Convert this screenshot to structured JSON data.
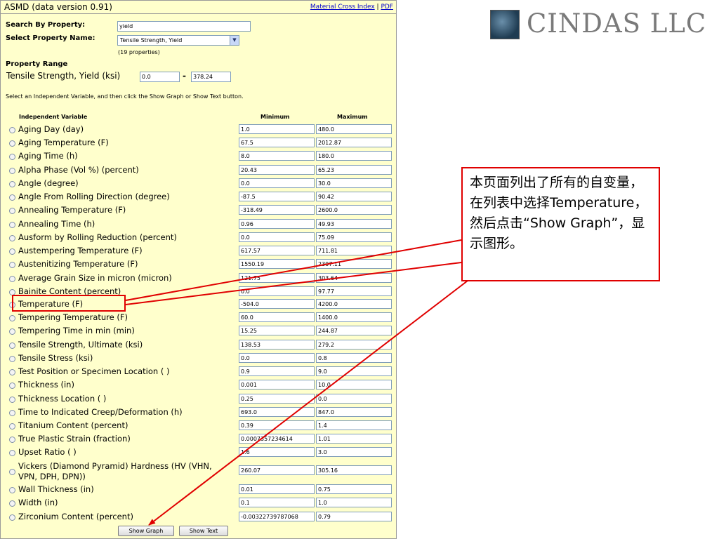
{
  "header": {
    "title": "ASMD (data version 0.91)",
    "link_material": "Material Cross Index",
    "link_sep": "|",
    "link_pdf": "PDF"
  },
  "search": {
    "label": "Search By Property:",
    "value": "yield"
  },
  "property_select": {
    "label": "Select Property Name:",
    "value": "Tensile Strength, Yield",
    "count": "(19 properties)"
  },
  "range": {
    "heading": "Property Range",
    "label": "Tensile Strength, Yield (ksi)",
    "min": "0.0",
    "dash": "-",
    "max": "378.24"
  },
  "instruction": "Select an Independent Variable, and then click the Show Graph or Show Text button.",
  "table": {
    "col_variable": "Independent Variable",
    "col_min": "Minimum",
    "col_max": "Maximum",
    "rows": [
      {
        "name": "Aging Day (day)",
        "min": "1.0",
        "max": "480.0"
      },
      {
        "name": "Aging Temperature (F)",
        "min": "67.5",
        "max": "2012.87"
      },
      {
        "name": "Aging Time (h)",
        "min": "8.0",
        "max": "180.0"
      },
      {
        "name": "Alpha Phase (Vol %) (percent)",
        "min": "20.43",
        "max": "65.23"
      },
      {
        "name": "Angle (degree)",
        "min": "0.0",
        "max": "30.0"
      },
      {
        "name": "Angle From Rolling Direction (degree)",
        "min": "-87.5",
        "max": "90.42"
      },
      {
        "name": "Annealing Temperature (F)",
        "min": "-318.49",
        "max": "2600.0"
      },
      {
        "name": "Annealing Time (h)",
        "min": "0.96",
        "max": "49.93"
      },
      {
        "name": "Ausform by Rolling Reduction (percent)",
        "min": "0.0",
        "max": "75.09"
      },
      {
        "name": "Austempering Temperature (F)",
        "min": "617.57",
        "max": "711.81"
      },
      {
        "name": "Austenitizing Temperature (F)",
        "min": "1550.19",
        "max": "2307.11"
      },
      {
        "name": "Average Grain Size in micron (micron)",
        "min": "121.75",
        "max": "303.64"
      },
      {
        "name": "Bainite Content (percent)",
        "min": "0.0",
        "max": "97.77"
      },
      {
        "name": "Temperature (F)",
        "min": "-504.0",
        "max": "4200.0"
      },
      {
        "name": "Tempering Temperature (F)",
        "min": "60.0",
        "max": "1400.0"
      },
      {
        "name": "Tempering Time in min (min)",
        "min": "15.25",
        "max": "244.87"
      },
      {
        "name": "Tensile Strength, Ultimate (ksi)",
        "min": "138.53",
        "max": "279.2"
      },
      {
        "name": "Tensile Stress (ksi)",
        "min": "0.0",
        "max": "0.8"
      },
      {
        "name": "Test Position or Specimen Location ( )",
        "min": "0.9",
        "max": "9.0"
      },
      {
        "name": "Thickness (in)",
        "min": "0.001",
        "max": "10.0"
      },
      {
        "name": "Thickness Location ( )",
        "min": "0.25",
        "max": "0.0"
      },
      {
        "name": "Time to Indicated Creep/Deformation (h)",
        "min": "693.0",
        "max": "847.0"
      },
      {
        "name": "Titanium Content (percent)",
        "min": "0.39",
        "max": "1.4"
      },
      {
        "name": "True Plastic Strain (fraction)",
        "min": "0.0007357234614",
        "max": "1.01"
      },
      {
        "name": "Upset Ratio ( )",
        "min": "1.6",
        "max": "3.0"
      },
      {
        "name": "Vickers (Diamond Pyramid) Hardness (HV (VHN, VPN, DPH, DPN))",
        "min": "260.07",
        "max": "305.16"
      },
      {
        "name": "Wall Thickness (in)",
        "min": "0.01",
        "max": "0.75"
      },
      {
        "name": "Width (in)",
        "min": "0.1",
        "max": "1.0"
      },
      {
        "name": "Zirconium Content (percent)",
        "min": "-0.00322739787068",
        "max": "0.79"
      }
    ]
  },
  "buttons": {
    "show_graph": "Show Graph",
    "show_text": "Show Text"
  },
  "logo": {
    "text": "CINDAS LLC"
  },
  "callout": {
    "text": "本页面列出了所有的自变量，在列表中选择Temperature，然后点击“Show Graph”，显示图形。"
  },
  "colors": {
    "panel_bg": "#ffffcc",
    "annotation": "#e00000",
    "link": "#0000cc"
  }
}
